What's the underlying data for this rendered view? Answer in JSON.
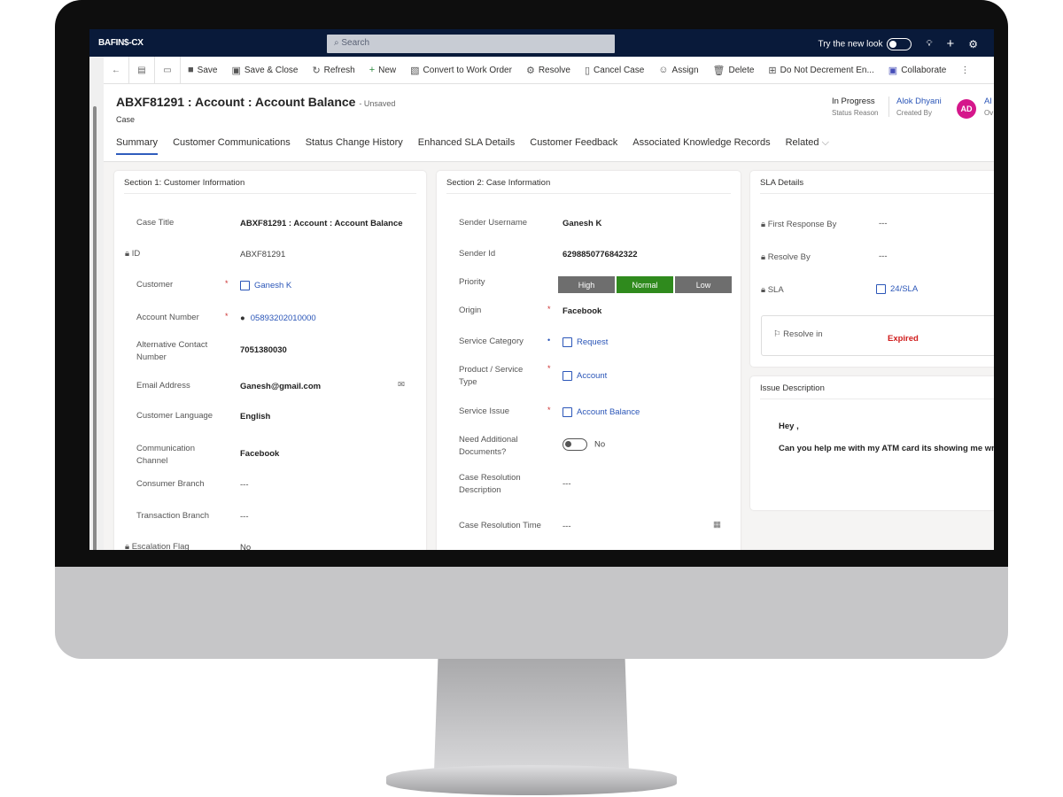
{
  "nav": {
    "brand": "BAFIN$-CX",
    "search_placeholder": "Search",
    "try_new_look": "Try the new look"
  },
  "toolbar": [
    "Save",
    "Save & Close",
    "Refresh",
    "New",
    "Convert to Work Order",
    "Resolve",
    "Cancel Case",
    "Assign",
    "Delete",
    "Do Not Decrement En...",
    "Collaborate"
  ],
  "header": {
    "title": "ABXF81291 : Account : Account Balance",
    "unsaved": "- Unsaved",
    "entity": "Case",
    "status": "In Progress",
    "status_label": "Status Reason",
    "created_by": "Alok Dhyani",
    "created_by_label": "Created By",
    "avatar": "AD",
    "owner_partial": "Al",
    "owner_label_partial": "Ov"
  },
  "tabs": [
    "Summary",
    "Customer Communications",
    "Status Change History",
    "Enhanced SLA Details",
    "Customer Feedback",
    "Associated Knowledge Records",
    "Related"
  ],
  "section1": {
    "title": "Section 1: Customer Information",
    "fields": [
      {
        "label": "Case Title",
        "value": "ABXF81291 : Account : Account Balance"
      },
      {
        "label": "ID",
        "value": "ABXF81291"
      },
      {
        "label": "Customer",
        "value": "Ganesh K"
      },
      {
        "label": "Account Number",
        "value": "05893202010000"
      },
      {
        "label": "Alternative Contact Number",
        "value": "7051380030"
      },
      {
        "label": "Email Address",
        "value": "Ganesh@gmail.com"
      },
      {
        "label": "Customer Language",
        "value": "English"
      },
      {
        "label": "Communication Channel",
        "value": "Facebook"
      },
      {
        "label": "Consumer Branch",
        "value": "---"
      },
      {
        "label": "Transaction Branch",
        "value": "---"
      },
      {
        "label": "Escalation Flag",
        "value": "No"
      }
    ]
  },
  "section2": {
    "title": "Section 2: Case Information",
    "fields": [
      {
        "label": "Sender Username",
        "value": "Ganesh K"
      },
      {
        "label": "Sender Id",
        "value": "6298850776842322"
      },
      {
        "label": "Priority",
        "options": [
          "High",
          "Normal",
          "Low"
        ],
        "selected": "Normal"
      },
      {
        "label": "Origin",
        "value": "Facebook"
      },
      {
        "label": "Service Category",
        "value": "Request"
      },
      {
        "label": "Product / Service Type",
        "value": "Account"
      },
      {
        "label": "Service Issue",
        "value": "Account Balance"
      },
      {
        "label": "Need Additional Documents?",
        "value": "No"
      },
      {
        "label": "Case Resolution Description",
        "value": "---"
      },
      {
        "label": "Case Resolution Time",
        "value": "---"
      }
    ]
  },
  "sla": {
    "title": "SLA Details",
    "first_response_label": "First Response By",
    "first_response": "---",
    "resolve_by_label": "Resolve By",
    "resolve_by": "---",
    "sla_label": "SLA",
    "sla": "24/SLA",
    "resolve_in_label": "Resolve in",
    "resolve_in": "Expired"
  },
  "issue": {
    "title": "Issue Description",
    "line1": "Hey ,",
    "line2": "Can you help me with my ATM card its showing me wro"
  },
  "colors": {
    "nav": "#091a3a",
    "accent": "#2f5dbd",
    "priority_selected": "#2f8a1d",
    "expired": "#d01c1c",
    "avatar": "#d5178b"
  }
}
